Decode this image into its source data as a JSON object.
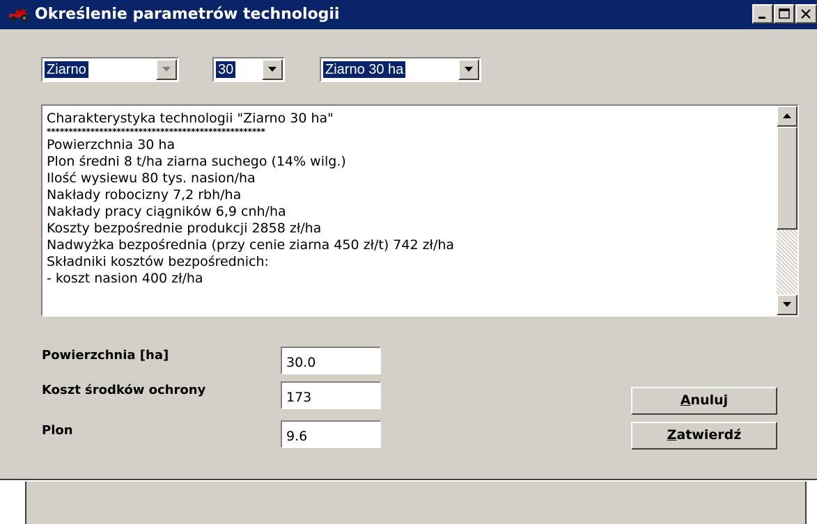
{
  "window": {
    "title": "Określenie parametrów technologii",
    "title_bar_color": "#0a246a",
    "face_color": "#d4d0c8",
    "controls": [
      "minimize-icon",
      "maximize-icon",
      "close-icon"
    ]
  },
  "selectors": {
    "crop": {
      "value": "Ziarno",
      "enabled": false
    },
    "area": {
      "value": "30",
      "enabled": true
    },
    "technology": {
      "value": "Ziarno 30 ha",
      "enabled": true
    }
  },
  "description": {
    "lines": [
      "Charakterystyka technologii \"Ziarno 30 ha\"",
      "**************************************************",
      "Powierzchnia 30 ha",
      "Plon średni 8 t/ha ziarna suchego (14% wilg.)",
      "Ilość wysiewu 80 tys. nasion/ha",
      "Nakłady robocizny 7,2 rbh/ha",
      "Nakłady pracy ciągników 6,9 cnh/ha",
      "Koszty bezpośrednie produkcji 2858 zł/ha",
      "Nadwyżka bezpośrednia (przy cenie ziarna 450 zł/t) 742 zł/ha",
      "Składniki kosztów bezpośrednich:",
      " - koszt nasion 400 zł/ha"
    ]
  },
  "fields": {
    "area": {
      "label": "Powierzchnia [ha]",
      "value": "30.0"
    },
    "protection_cost": {
      "label": "Koszt środków ochrony",
      "value": "173"
    },
    "yield": {
      "label": "Plon",
      "value": "9.6"
    }
  },
  "buttons": {
    "cancel": {
      "hotkey": "A",
      "rest": "nuluj"
    },
    "confirm": {
      "hotkey": "Z",
      "rest": "atwierdź"
    }
  }
}
